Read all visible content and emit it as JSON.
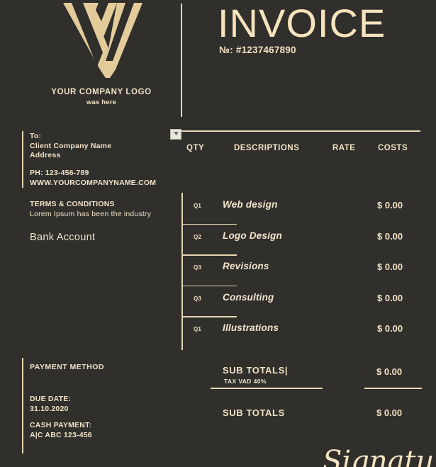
{
  "document": {
    "type": "invoice",
    "background_color": "#302f2c",
    "accent_color": "#e9d8b4",
    "text_color": "#f0e2c6"
  },
  "header": {
    "logo": {
      "icon": "nested-v-monogram",
      "company_name": "YOUR COMPANY LOGO",
      "tagline": "was here"
    },
    "title": "INVOICE",
    "invoice_number_label": "№: #1237467890"
  },
  "bill_to": {
    "label": "To:",
    "company": "Client Company Name",
    "address": "Address"
  },
  "contact": {
    "phone": "PH:  123-456-789",
    "website": "WWW.YOURCOMPANYNAME.COM"
  },
  "terms": {
    "heading": "TERMS & CONDITIONS",
    "body": "Lorem Ipsum has been the industry"
  },
  "bank": {
    "heading": "Bank Account"
  },
  "payment": {
    "method_heading": "PAYMENT METHOD",
    "due_date_label": "DUE DATE:",
    "due_date_value": "31.10.2020",
    "cash_label": "CASH PAYMENT:",
    "cash_value": "A|C ABC 123-456"
  },
  "table": {
    "columns": {
      "qty": "QTY",
      "description": "DESCRIPTIONS",
      "rate": "RATE",
      "costs": "COSTS"
    },
    "rows": [
      {
        "qty": "Q1",
        "description": "Web design",
        "rate": "",
        "cost": "$ 0.00"
      },
      {
        "qty": "Q2",
        "description": "Logo Design",
        "rate": "",
        "cost": "$ 0.00"
      },
      {
        "qty": "Q3",
        "description": "Revisions",
        "rate": "",
        "cost": "$ 0.00"
      },
      {
        "qty": "Q3",
        "description": "Consulting",
        "rate": "",
        "cost": "$ 0.00"
      },
      {
        "qty": "Q1",
        "description": "Illustrations",
        "rate": "",
        "cost": "$ 0.00"
      }
    ]
  },
  "totals": {
    "subtotal_label": "SUB TOTALS|",
    "tax_label": "TAX VAD 40%",
    "subtotal_amount": "$ 0.00",
    "total_label": "SUB TOTALS",
    "total_amount": "$ 0.00"
  },
  "signature": {
    "text": "Signature"
  }
}
